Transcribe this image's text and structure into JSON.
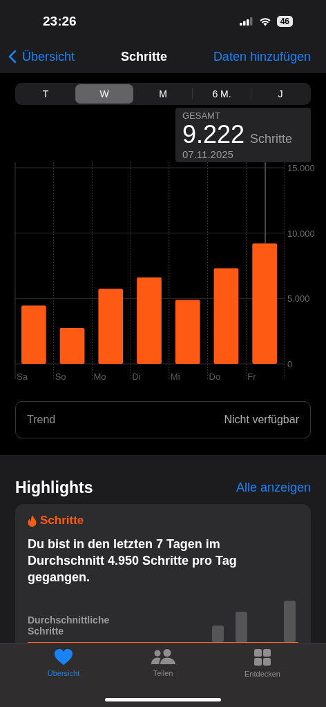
{
  "status_bar": {
    "time": "23:26",
    "battery": "46"
  },
  "nav": {
    "back": "Übersicht",
    "title": "Schritte",
    "action": "Daten hinzufügen"
  },
  "segments": [
    {
      "label": "T",
      "selected": false
    },
    {
      "label": "W",
      "selected": true
    },
    {
      "label": "M",
      "selected": false
    },
    {
      "label": "6 M.",
      "selected": false
    },
    {
      "label": "J",
      "selected": false
    }
  ],
  "tooltip": {
    "label": "GESAMT",
    "value": "9.222",
    "unit": "Schritte",
    "date": "07.11.2025"
  },
  "chart_data": {
    "type": "bar",
    "categories": [
      "Sa",
      "So",
      "Mo",
      "Di",
      "Mi",
      "Do",
      "Fr"
    ],
    "values": [
      4460,
      2750,
      5740,
      6620,
      4900,
      7310,
      9222
    ],
    "ylim": [
      0,
      15000
    ],
    "yticks": [
      {
        "value": 0,
        "label": "0"
      },
      {
        "value": 5000,
        "label": "5.000"
      },
      {
        "value": 10000,
        "label": "10.000"
      },
      {
        "value": 15000,
        "label": "15.000"
      }
    ]
  },
  "trend": {
    "label": "Trend",
    "value": "Nicht verfügbar"
  },
  "highlights": {
    "title": "Highlights",
    "link": "Alle anzeigen",
    "card": {
      "category": "Schritte",
      "text": "Du bist in den letzten 7 Tagen im Durchschnitt 4.950 Schritte pro Tag gegangen.",
      "chart_label": "Durchschnittliche Schritte"
    }
  },
  "tab_bar": [
    {
      "label": "Übersicht",
      "selected": true,
      "kind": "heart"
    },
    {
      "label": "Teilen",
      "selected": false,
      "kind": "people"
    },
    {
      "label": "Entdecken",
      "selected": false,
      "kind": "grid"
    }
  ]
}
